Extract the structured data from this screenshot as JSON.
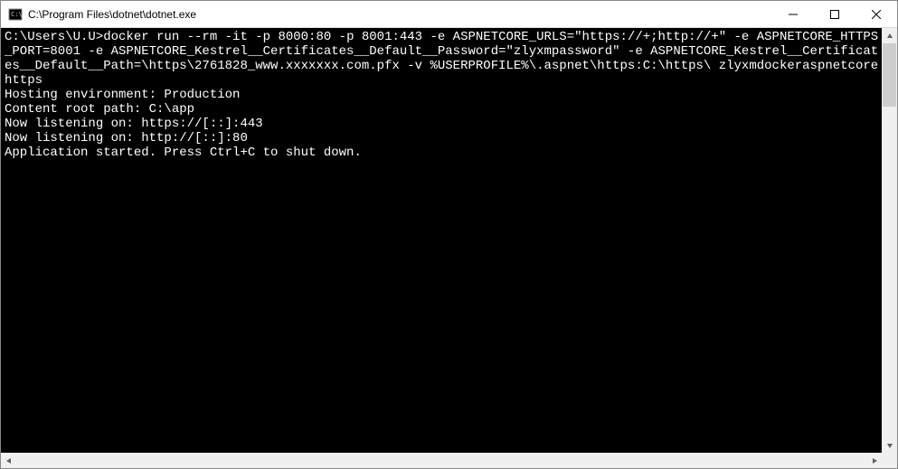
{
  "window": {
    "title": "C:\\Program Files\\dotnet\\dotnet.exe"
  },
  "terminal": {
    "prompt": "C:\\Users\\U.U>",
    "command": "docker run --rm -it -p 8000:80 -p 8001:443 -e ASPNETCORE_URLS=\"https://+;http://+\" -e ASPNETCORE_HTTPS_PORT=8001 -e ASPNETCORE_Kestrel__Certificates__Default__Password=\"zlyxmpassword\" -e ASPNETCORE_Kestrel__Certificates__Default__Path=\\https\\2761828_www.xxxxxxx.com.pfx -v %USERPROFILE%\\.aspnet\\https:C:\\https\\ zlyxmdockeraspnetcorehttps",
    "output": {
      "line1": "Hosting environment: Production",
      "line2": "Content root path: C:\\app",
      "line3": "Now listening on: https://[::]:443",
      "line4": "Now listening on: http://[::]:80",
      "line5": "Application started. Press Ctrl+C to shut down."
    }
  }
}
